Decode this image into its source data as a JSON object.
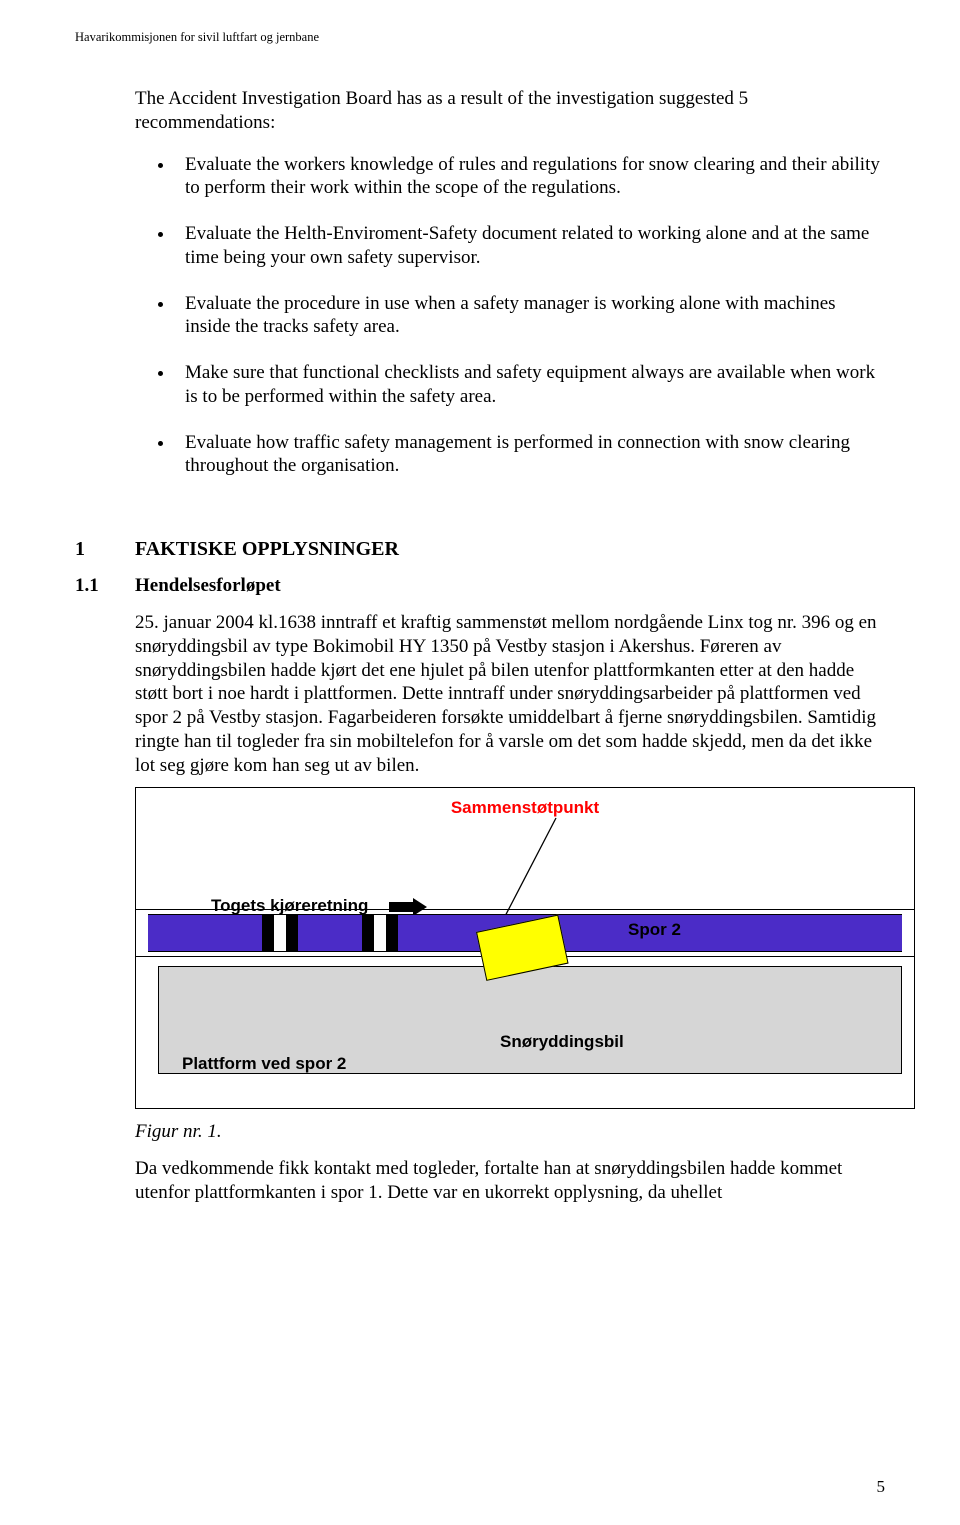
{
  "header": "Havarikommisjonen for sivil luftfart og jernbane",
  "intro": "The Accident Investigation Board has as a result of the investigation suggested 5 recommendations:",
  "recs": [
    "Evaluate the workers knowledge of rules and regulations for snow clearing and their ability to perform their work within the scope of the regulations.",
    "Evaluate the Helth-Enviroment-Safety document related to working alone and at the same time being your own safety supervisor.",
    "Evaluate the procedure in use when a safety manager is working alone with machines inside the tracks safety area.",
    "Make sure that functional checklists and safety equipment always are available when work is to be performed within the safety area.",
    "Evaluate how traffic safety management is performed in connection with snow clearing throughout the organisation."
  ],
  "section": {
    "num": "1",
    "title": "FAKTISKE OPPLYSNINGER"
  },
  "subsection": {
    "num": "1.1",
    "title": "Hendelsesforløpet"
  },
  "para1": "25. januar 2004 kl.1638 inntraff et kraftig sammenstøt mellom nordgående Linx tog nr. 396 og en snøryddingsbil av type Bokimobil HY 1350 på Vestby stasjon i Akershus. Føreren av snøryddingsbilen hadde kjørt det ene hjulet på bilen utenfor plattformkanten etter at den hadde støtt bort i noe hardt i plattformen. Dette inntraff under snøryddingsarbeider på plattformen ved spor 2 på Vestby stasjon. Fagarbeideren forsøkte umiddelbart å fjerne snøryddingsbilen. Samtidig ringte han til togleder fra sin mobiltelefon for å varsle om det som hadde skjedd, men da det ikke lot seg gjøre kom han seg ut av bilen.",
  "diagram": {
    "impact": "Sammenstøtpunkt",
    "train_dir": "Togets kjøreretning",
    "track": "Spor 2",
    "plow": "Snøryddingsbil",
    "platform": "Plattform ved spor 2"
  },
  "figcaption": "Figur nr. 1.",
  "para2": "Da vedkommende fikk kontakt med togleder, fortalte han at snøryddingsbilen hadde kommet utenfor plattformkanten i spor 1. Dette var en ukorrekt opplysning, da uhellet",
  "page_number": "5"
}
